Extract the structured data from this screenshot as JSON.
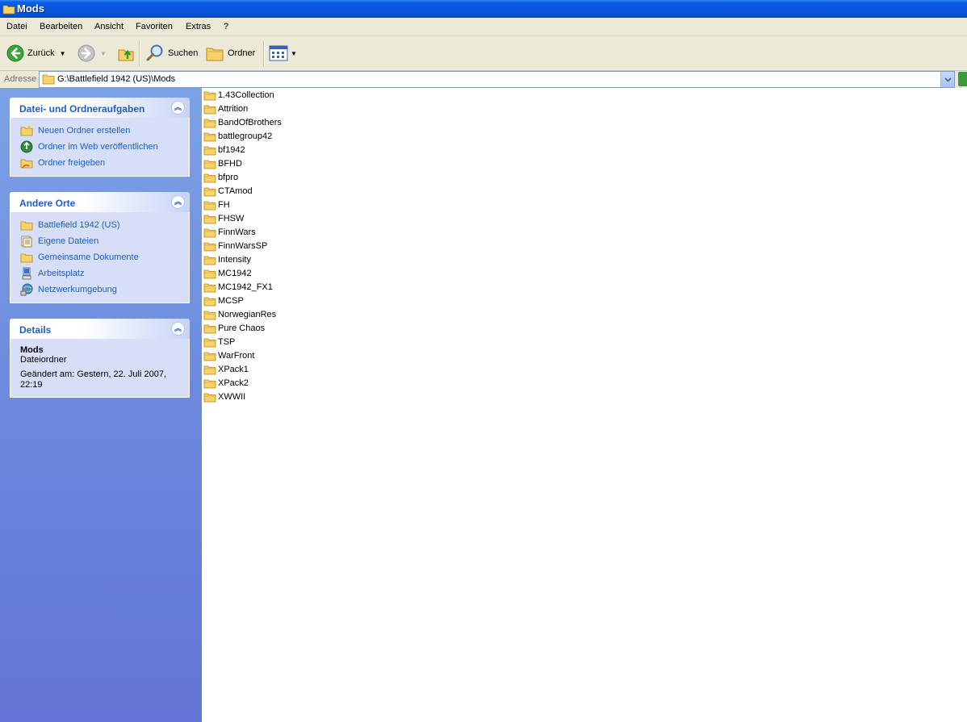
{
  "window": {
    "title": "Mods"
  },
  "menu": [
    "Datei",
    "Bearbeiten",
    "Ansicht",
    "Favoriten",
    "Extras",
    "?"
  ],
  "toolbar": {
    "back": "Zurück",
    "search": "Suchen",
    "folders": "Ordner"
  },
  "address": {
    "label": "Adresse",
    "value": "G:\\Battlefield 1942 (US)\\Mods"
  },
  "tasks": {
    "title": "Datei- und Ordneraufgaben",
    "items": [
      "Neuen Ordner erstellen",
      "Ordner im Web veröffentlichen",
      "Ordner freigeben"
    ]
  },
  "places": {
    "title": "Andere Orte",
    "items": [
      "Battlefield 1942 (US)",
      "Eigene Dateien",
      "Gemeinsame Dokumente",
      "Arbeitsplatz",
      "Netzwerkumgebung"
    ]
  },
  "details": {
    "title": "Details",
    "name": "Mods",
    "type": "Dateiordner",
    "modified": "Geändert am: Gestern, 22. Juli 2007, 22:19"
  },
  "files": [
    "1.43Collection",
    "Attrition",
    "BandOfBrothers",
    "battlegroup42",
    "bf1942",
    "BFHD",
    "bfpro",
    "CTAmod",
    "FH",
    "FHSW",
    "FinnWars",
    "FinnWarsSP",
    "Intensity",
    "MC1942",
    "MC1942_FX1",
    "MCSP",
    "NorwegianRes",
    "Pure Chaos",
    "TSP",
    "WarFront",
    "XPack1",
    "XPack2",
    "XWWII"
  ],
  "colors": {
    "titlebar": "#0554e0",
    "taskpane": "#6a84dc",
    "link": "#215dc6",
    "folder": "#f5d36a"
  }
}
